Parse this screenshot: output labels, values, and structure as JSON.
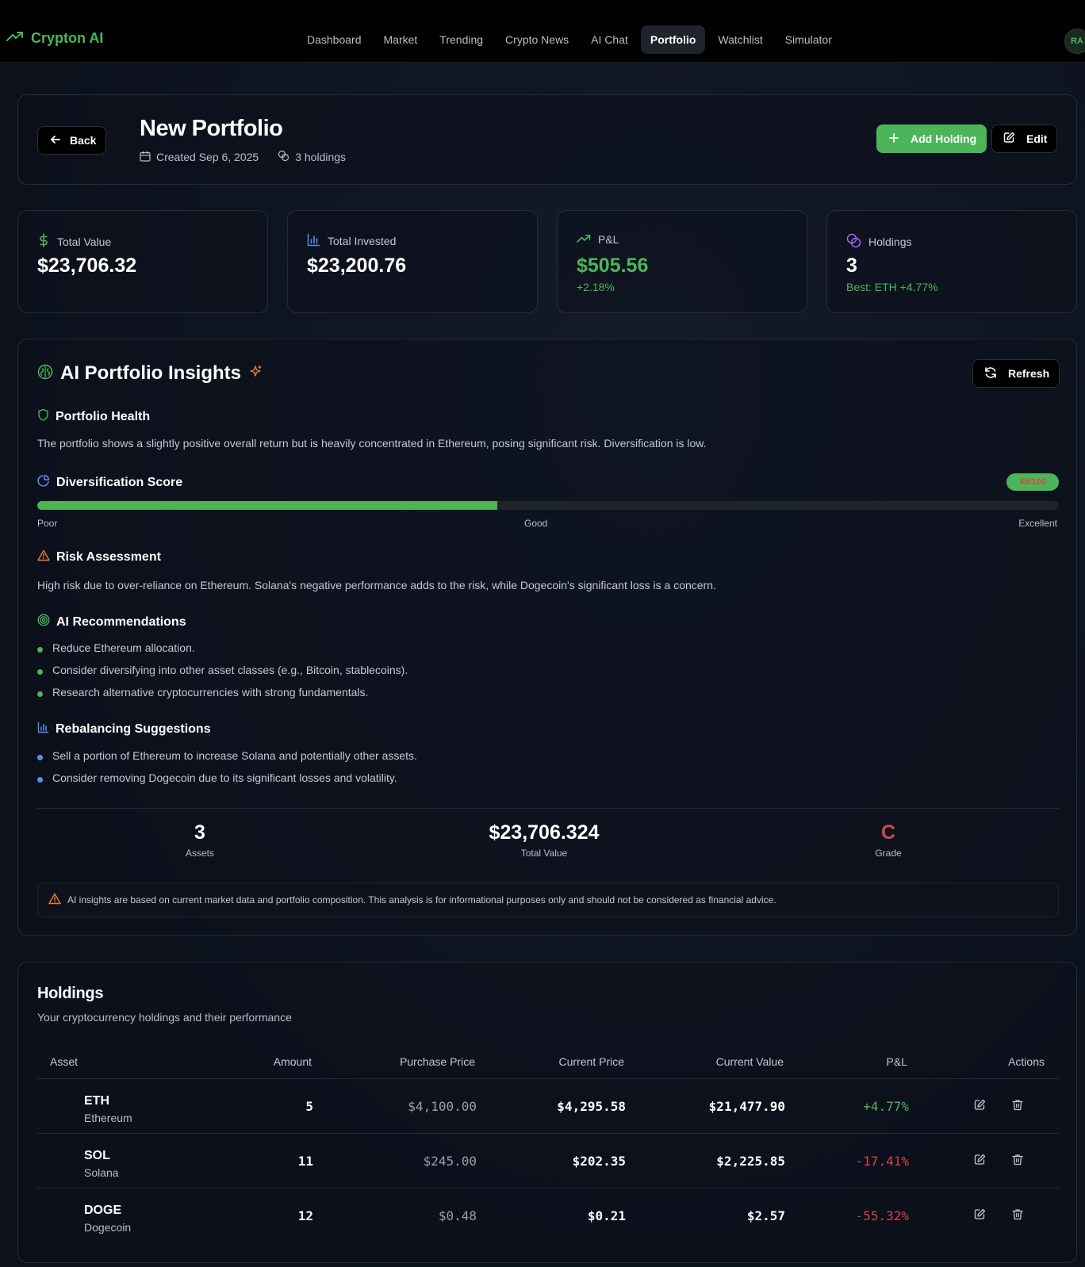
{
  "nav": {
    "brand": "Crypton AI",
    "links": [
      "Dashboard",
      "Market",
      "Trending",
      "Crypto News",
      "AI Chat",
      "Portfolio",
      "Watchlist",
      "Simulator"
    ],
    "active_index": 5,
    "avatar_initials": "RA",
    "brand_color": "#4cb55a"
  },
  "header": {
    "back_label": "Back",
    "title": "New Portfolio",
    "created": "Created Sep 6, 2025",
    "holdings_count": "3 holdings",
    "add_label": "Add Holding",
    "edit_label": "Edit"
  },
  "stats": [
    {
      "label": "Total Value",
      "value": "$23,706.32",
      "sub": "",
      "icon": "dollar-icon"
    },
    {
      "label": "Total Invested",
      "value": "$23,200.76",
      "sub": "",
      "icon": "bar-chart-icon"
    },
    {
      "label": "P&L",
      "value": "$505.56",
      "sub": "+2.18%",
      "icon": "trending-up-icon"
    },
    {
      "label": "Holdings",
      "value": "3",
      "sub": "Best: ETH +4.77%",
      "icon": "coins-icon"
    }
  ],
  "insights": {
    "title": "AI Portfolio Insights",
    "refresh_label": "Refresh",
    "health": {
      "title": "Portfolio Health",
      "text": "The portfolio shows a slightly positive overall return but is heavily concentrated in Ethereum, posing significant risk. Diversification is low."
    },
    "diversification": {
      "title": "Diversification Score",
      "score_label": "45/100",
      "score_fraction": 0.45,
      "scale": [
        "Poor",
        "Good",
        "Excellent"
      ]
    },
    "risk": {
      "title": "Risk Assessment",
      "text": "High risk due to over-reliance on Ethereum. Solana's negative performance adds to the risk, while Dogecoin's significant loss is a concern."
    },
    "recommendations": {
      "title": "AI Recommendations",
      "items": [
        "Reduce Ethereum allocation.",
        "Consider diversifying into other asset classes (e.g., Bitcoin, stablecoins).",
        "Research alternative cryptocurrencies with strong fundamentals."
      ]
    },
    "rebalancing": {
      "title": "Rebalancing Suggestions",
      "items": [
        "Sell a portion of Ethereum to increase Solana and potentially other assets.",
        "Consider removing Dogecoin due to its significant losses and volatility."
      ]
    },
    "summary": [
      {
        "value": "3",
        "label": "Assets"
      },
      {
        "value": "$23,706.324",
        "label": "Total Value"
      },
      {
        "value": "C",
        "label": "Grade"
      }
    ],
    "disclaimer": "AI insights are based on current market data and portfolio composition. This analysis is for informational purposes only and should not be considered as financial advice."
  },
  "holdings": {
    "title": "Holdings",
    "subtitle": "Your cryptocurrency holdings and their performance",
    "columns": [
      "Asset",
      "Amount",
      "Purchase Price",
      "Current Price",
      "Current Value",
      "P&L",
      "Actions"
    ],
    "rows": [
      {
        "symbol": "ETH",
        "name": "Ethereum",
        "amount": "5",
        "purchase": "$4,100.00",
        "current": "$4,295.58",
        "value": "$21,477.90",
        "pnl": "+4.77%",
        "positive": true
      },
      {
        "symbol": "SOL",
        "name": "Solana",
        "amount": "11",
        "purchase": "$245.00",
        "current": "$202.35",
        "value": "$2,225.85",
        "pnl": "-17.41%",
        "positive": false
      },
      {
        "symbol": "DOGE",
        "name": "Dogecoin",
        "amount": "12",
        "purchase": "$0.48",
        "current": "$0.21",
        "value": "$2.57",
        "pnl": "-55.32%",
        "positive": false
      }
    ]
  },
  "colors": {
    "green": "#4cb55a",
    "red": "#d64545",
    "blue": "#5b8ff0",
    "purple": "#a463f2",
    "orange": "#f07a35"
  }
}
